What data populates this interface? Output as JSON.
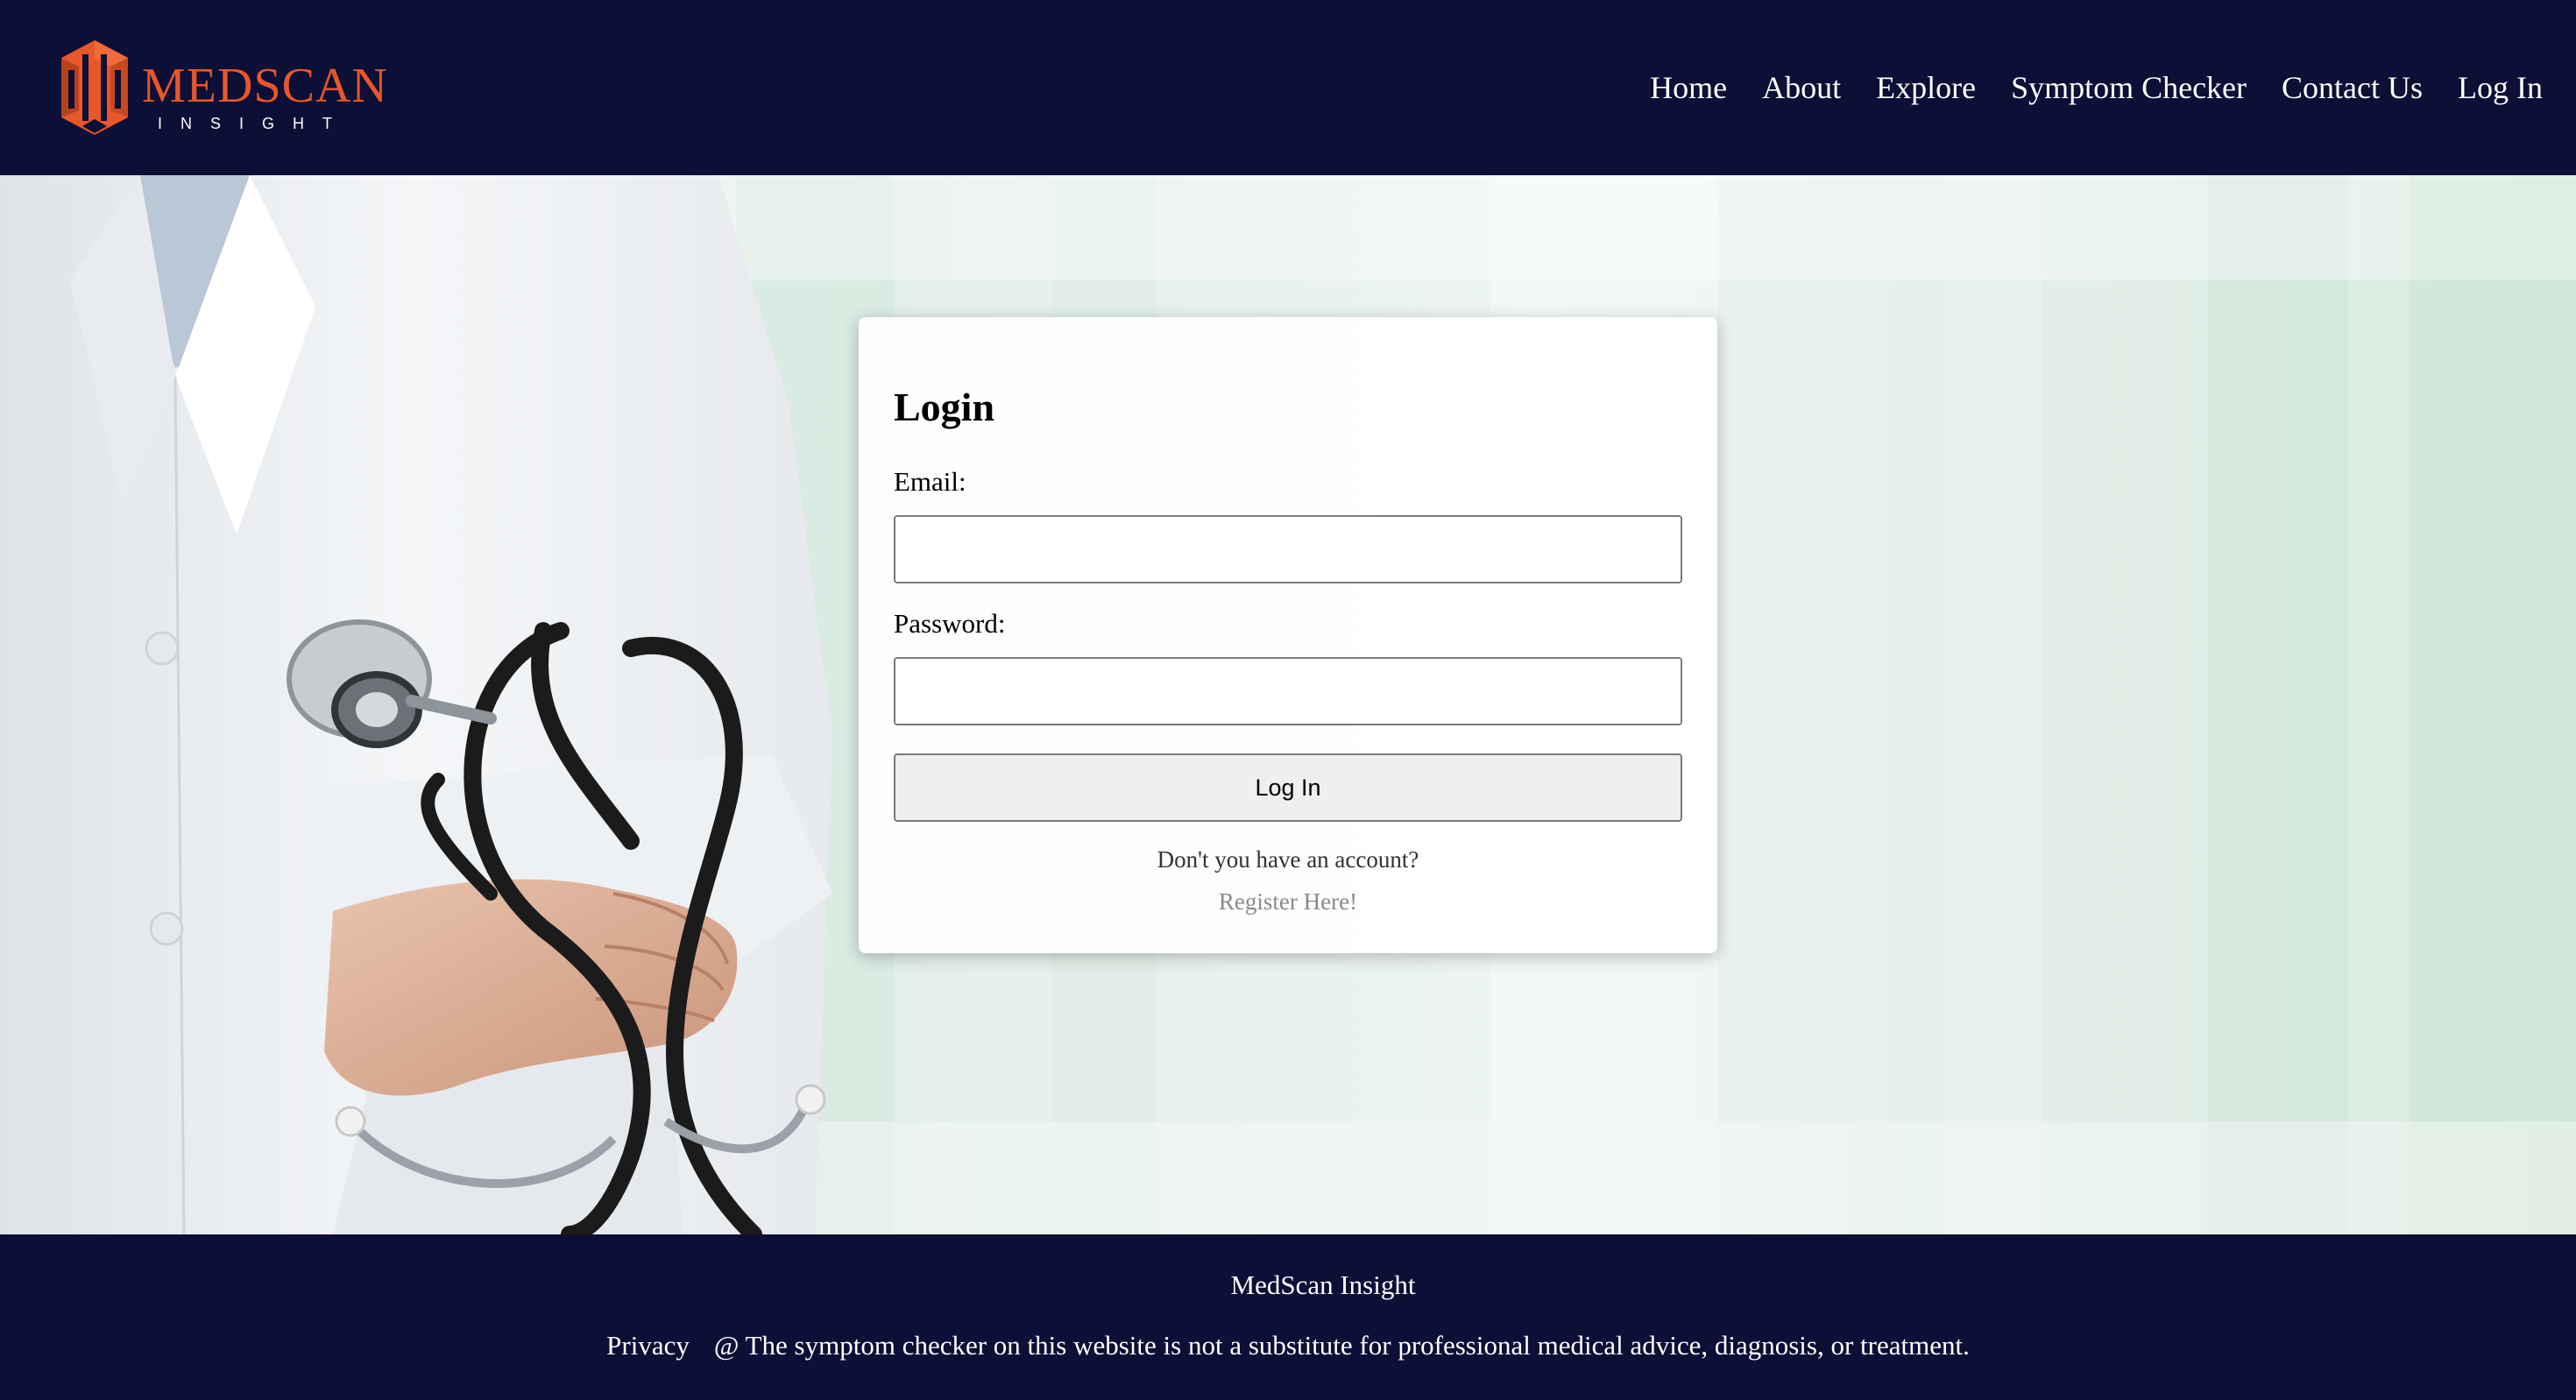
{
  "brand": {
    "name_line1": "MEDSCAN",
    "name_line2": "INSIGHT",
    "logo_color": "#e8572a"
  },
  "nav": {
    "items": [
      {
        "label": "Home"
      },
      {
        "label": "About"
      },
      {
        "label": "Explore"
      },
      {
        "label": "Symptom Checker"
      },
      {
        "label": "Contact Us"
      },
      {
        "label": "Log In"
      }
    ]
  },
  "login": {
    "title": "Login",
    "email_label": "Email:",
    "email_value": "",
    "password_label": "Password:",
    "password_value": "",
    "submit_label": "Log In",
    "no_account_text": "Don't you have an account?",
    "register_link": "Register Here!"
  },
  "footer": {
    "brand": "MedScan Insight",
    "privacy_link": "Privacy",
    "disclaimer": "@ The symptom checker on this website is not a substitute for professional medical advice, diagnosis, or treatment."
  },
  "colors": {
    "header_bg": "#0c0f36",
    "footer_bg": "#0c0f36",
    "accent": "#e8572a"
  }
}
